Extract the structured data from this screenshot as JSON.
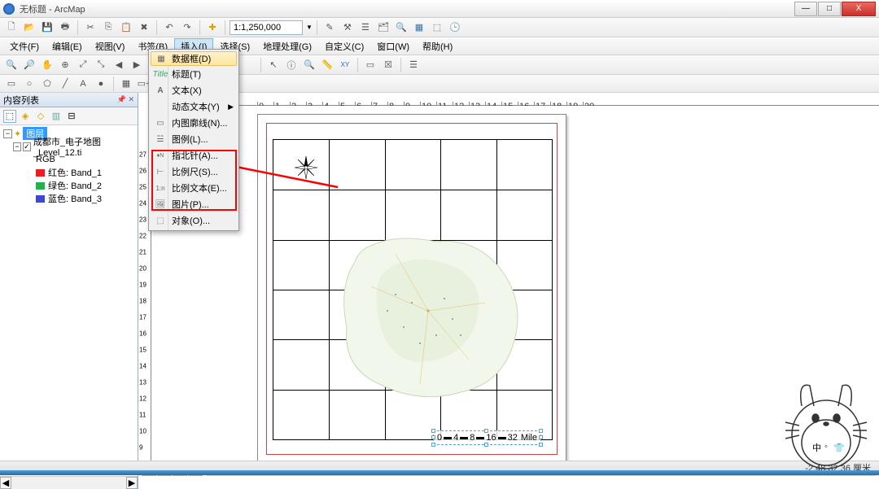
{
  "window": {
    "title": "无标题 - ArcMap",
    "min": "—",
    "max": "□",
    "close": "X"
  },
  "menubar": {
    "file": "文件(F)",
    "edit": "编辑(E)",
    "view": "视图(V)",
    "bookmark": "书签(B)",
    "insert": "插入(I)",
    "select": "选择(S)",
    "geoprocess": "地理处理(G)",
    "customize": "自定义(C)",
    "window": "窗口(W)",
    "help": "帮助(H)"
  },
  "scale": "1:1,250,000",
  "dropdown": {
    "dataframe": "数据框(D)",
    "title_item": "标题(T)",
    "text": "文本(X)",
    "dynamic_text": "动态文本(Y)",
    "neatline": "内图廓线(N)...",
    "legend": "图例(L)...",
    "north_arrow": "指北针(A)...",
    "scale_bar": "比例尺(S)...",
    "scale_text": "比例文本(E)...",
    "picture": "图片(P)...",
    "object": "对象(O)..."
  },
  "toc": {
    "title": "内容列表",
    "layers": "图层",
    "layer_name": "成都市_电子地图_Level_12.ti",
    "rgb": "RGB",
    "red": "红色:  Band_1",
    "green": "绿色:  Band_2",
    "blue": "蓝色:  Band_3"
  },
  "scalebar_labels": {
    "a": "0",
    "b": "4",
    "c": "8",
    "d": "16",
    "e": "32",
    "unit": "Mile"
  },
  "status": {
    "coords": "-2.48 32.36 厘米"
  },
  "mascot_text": {
    "a": "中",
    "b": "◦",
    "c": "★"
  }
}
